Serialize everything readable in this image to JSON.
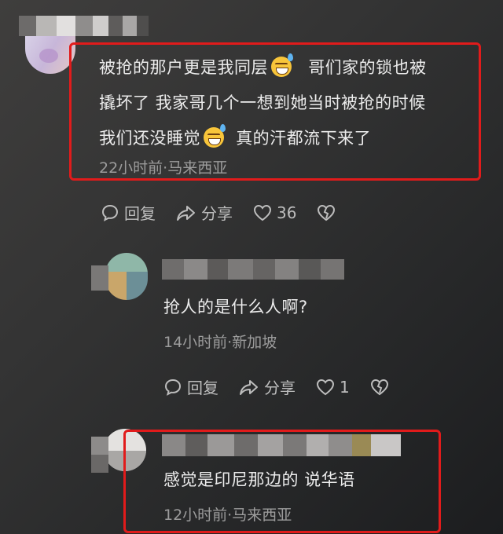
{
  "comments": [
    {
      "lines": [
        "被抢的那户更是我同层",
        "哥们家的锁也被",
        "撬坏了 我家哥几个一想到她当时被抢的时候",
        "我们还没睡觉",
        "真的汗都流下来了"
      ],
      "meta": "22小时前·马来西亚",
      "reply_label": "回复",
      "share_label": "分享",
      "likes": "36"
    },
    {
      "text": "抢人的是什么人啊?",
      "meta": "14小时前·新加坡",
      "reply_label": "回复",
      "share_label": "分享",
      "likes": "1"
    },
    {
      "text": "感觉是印尼那边的 说华语",
      "meta": "12小时前·马来西亚"
    }
  ],
  "colors": {
    "highlight": "#e11b1b",
    "text": "#ececec",
    "meta": "#9c9c9c"
  },
  "icons": [
    "reply-icon",
    "share-icon",
    "heart-icon",
    "dislike-heart-icon",
    "grin-sweat-emoji"
  ]
}
